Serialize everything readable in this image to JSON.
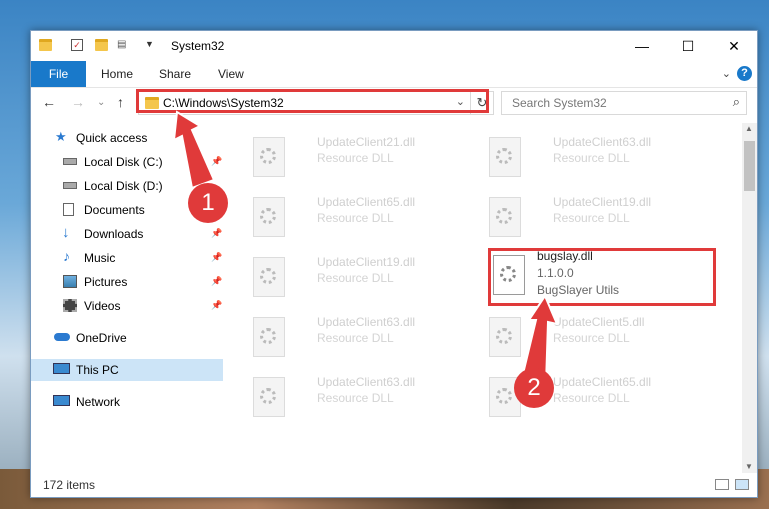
{
  "window": {
    "title": "System32",
    "ribbon_tabs": [
      "File",
      "Home",
      "Share",
      "View"
    ],
    "help_label": "?",
    "caption": {
      "minimize": "—",
      "maximize": "☐",
      "close": "✕"
    }
  },
  "address_bar": {
    "path": "C:\\Windows\\System32",
    "search_placeholder": "Search System32"
  },
  "sidebar": {
    "items": [
      {
        "label": "Quick access",
        "icon": "star-icon"
      },
      {
        "label": "Local Disk (C:)",
        "icon": "drive-icon",
        "pinned": true
      },
      {
        "label": "Local Disk (D:)",
        "icon": "drive-icon"
      },
      {
        "label": "Documents",
        "icon": "documents-icon"
      },
      {
        "label": "Downloads",
        "icon": "download-icon",
        "pinned": true
      },
      {
        "label": "Music",
        "icon": "music-icon",
        "pinned": true
      },
      {
        "label": "Pictures",
        "icon": "pictures-icon",
        "pinned": true
      },
      {
        "label": "Videos",
        "icon": "videos-icon",
        "pinned": true
      },
      {
        "label": "OneDrive",
        "icon": "cloud-icon"
      },
      {
        "label": "This PC",
        "icon": "computer-icon",
        "selected": true
      },
      {
        "label": "Network",
        "icon": "network-icon"
      }
    ]
  },
  "files": [
    {
      "name": "UpdateClient21.dll",
      "desc": "Resource DLL"
    },
    {
      "name": "UpdateClient63.dll",
      "desc": "Resource DLL"
    },
    {
      "name": "UpdateClient65.dll",
      "desc": "Resource DLL"
    },
    {
      "name": "UpdateClient19.dll",
      "desc": "Resource DLL"
    },
    {
      "name": "UpdateClient19.dll",
      "desc": "Resource DLL"
    },
    {
      "name": "bugslay.dll",
      "version": "1.1.0.0",
      "desc": "BugSlayer Utils",
      "focused": true
    },
    {
      "name": "UpdateClient63.dll",
      "desc": "Resource DLL"
    },
    {
      "name": "UpdateClient5.dll",
      "desc": "Resource DLL"
    },
    {
      "name": "UpdateClient63.dll",
      "desc": "Resource DLL"
    },
    {
      "name": "UpdateClient65.dll",
      "desc": "Resource DLL"
    }
  ],
  "status": {
    "item_count": "172 items"
  },
  "annotations": {
    "step1": "1",
    "step2": "2"
  },
  "colors": {
    "accent": "#1979ca",
    "highlight": "#e03a3a",
    "selected": "#cce4f7"
  }
}
